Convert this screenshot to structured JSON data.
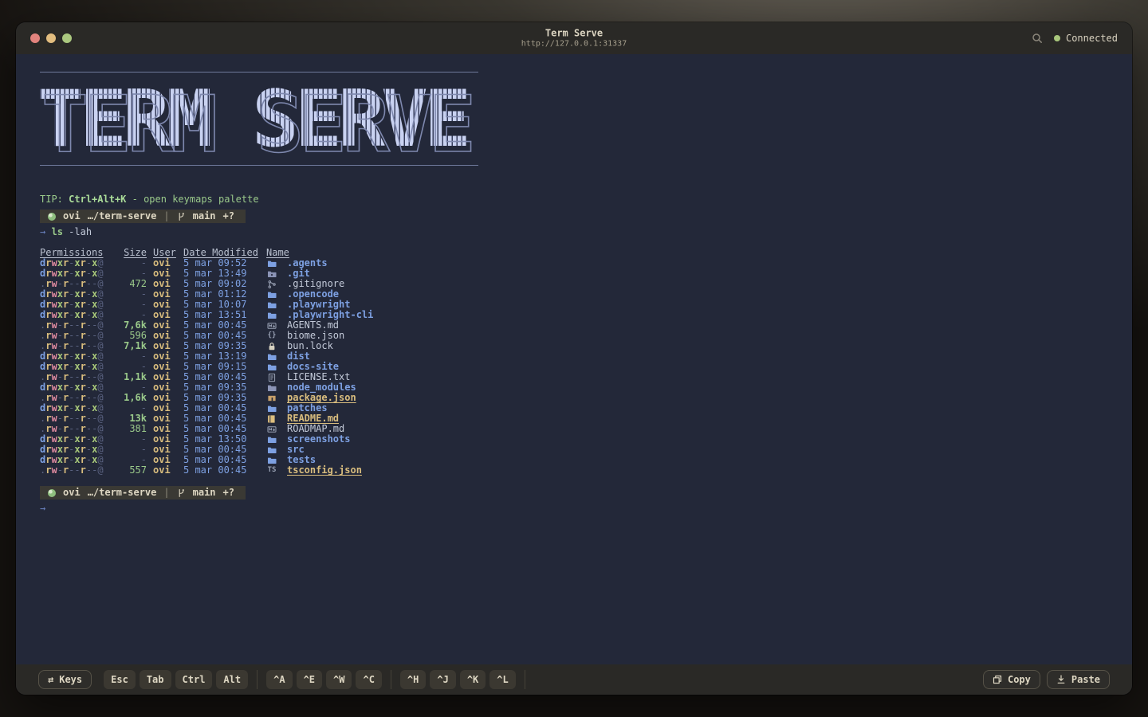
{
  "window": {
    "title": "Term Serve",
    "url": "http://127.0.0.1:31337",
    "connection_status": "Connected"
  },
  "logo": {
    "text": "TERM SERVE"
  },
  "tip": {
    "label": "TIP:",
    "hotkey": "Ctrl+Alt+K",
    "description": "- open keymaps palette"
  },
  "prompt": {
    "user": "ovi",
    "path": "…/term-serve",
    "separator": "|",
    "branch": "main",
    "git_flags": "+?"
  },
  "command": {
    "prompt_arrow": "→",
    "name": "ls",
    "args": "-lah"
  },
  "input_line": {
    "prompt_arrow": "→"
  },
  "listing": {
    "headers": [
      "Permissions",
      "Size",
      "User",
      "Date Modified",
      "Name"
    ],
    "rows": [
      {
        "perms": "drwxr-xr-x@",
        "size": "-",
        "user": "ovi",
        "date": "5 mar 09:52",
        "icon": "folder",
        "name": ".agents",
        "kind": "dir"
      },
      {
        "perms": "drwxr-xr-x@",
        "size": "-",
        "user": "ovi",
        "date": "5 mar 13:49",
        "icon": "folder-git",
        "name": ".git",
        "kind": "dir"
      },
      {
        "perms": ".rw-r--r--@",
        "size": "472",
        "user": "ovi",
        "date": "5 mar 09:02",
        "icon": "git",
        "name": ".gitignore",
        "kind": "file"
      },
      {
        "perms": "drwxr-xr-x@",
        "size": "-",
        "user": "ovi",
        "date": "5 mar 01:12",
        "icon": "folder",
        "name": ".opencode",
        "kind": "dir"
      },
      {
        "perms": "drwxr-xr-x@",
        "size": "-",
        "user": "ovi",
        "date": "5 mar 10:07",
        "icon": "folder",
        "name": ".playwright",
        "kind": "dir"
      },
      {
        "perms": "drwxr-xr-x@",
        "size": "-",
        "user": "ovi",
        "date": "5 mar 13:51",
        "icon": "folder",
        "name": ".playwright-cli",
        "kind": "dir"
      },
      {
        "perms": ".rw-r--r--@",
        "size": "7,6k",
        "user": "ovi",
        "date": "5 mar 00:45",
        "icon": "markdown",
        "name": "AGENTS.md",
        "kind": "file"
      },
      {
        "perms": ".rw-r--r--@",
        "size": "596",
        "user": "ovi",
        "date": "5 mar 00:45",
        "icon": "braces",
        "name": "biome.json",
        "kind": "file"
      },
      {
        "perms": ".rw-r--r--@",
        "size": "7,1k",
        "user": "ovi",
        "date": "5 mar 09:35",
        "icon": "lock",
        "name": "bun.lock",
        "kind": "file"
      },
      {
        "perms": "drwxr-xr-x@",
        "size": "-",
        "user": "ovi",
        "date": "5 mar 13:19",
        "icon": "folder",
        "name": "dist",
        "kind": "dir"
      },
      {
        "perms": "drwxr-xr-x@",
        "size": "-",
        "user": "ovi",
        "date": "5 mar 09:15",
        "icon": "folder",
        "name": "docs-site",
        "kind": "dir"
      },
      {
        "perms": ".rw-r--r--@",
        "size": "1,1k",
        "user": "ovi",
        "date": "5 mar 00:45",
        "icon": "doc",
        "name": "LICENSE.txt",
        "kind": "file"
      },
      {
        "perms": "drwxr-xr-x@",
        "size": "-",
        "user": "ovi",
        "date": "5 mar 09:35",
        "icon": "folder-npm",
        "name": "node_modules",
        "kind": "dir"
      },
      {
        "perms": ".rw-r--r--@",
        "size": "1,6k",
        "user": "ovi",
        "date": "5 mar 09:35",
        "icon": "npm",
        "name": "package.json",
        "kind": "special"
      },
      {
        "perms": "drwxr-xr-x@",
        "size": "-",
        "user": "ovi",
        "date": "5 mar 00:45",
        "icon": "folder",
        "name": "patches",
        "kind": "dir"
      },
      {
        "perms": ".rw-r--r--@",
        "size": "13k",
        "user": "ovi",
        "date": "5 mar 00:45",
        "icon": "book",
        "name": "README.md",
        "kind": "special"
      },
      {
        "perms": ".rw-r--r--@",
        "size": "381",
        "user": "ovi",
        "date": "5 mar 00:45",
        "icon": "markdown",
        "name": "ROADMAP.md",
        "kind": "file"
      },
      {
        "perms": "drwxr-xr-x@",
        "size": "-",
        "user": "ovi",
        "date": "5 mar 13:50",
        "icon": "folder",
        "name": "screenshots",
        "kind": "dir"
      },
      {
        "perms": "drwxr-xr-x@",
        "size": "-",
        "user": "ovi",
        "date": "5 mar 00:45",
        "icon": "folder",
        "name": "src",
        "kind": "dir"
      },
      {
        "perms": "drwxr-xr-x@",
        "size": "-",
        "user": "ovi",
        "date": "5 mar 00:45",
        "icon": "folder",
        "name": "tests",
        "kind": "dir"
      },
      {
        "perms": ".rw-r--r--@",
        "size": "557",
        "user": "ovi",
        "date": "5 mar 00:45",
        "icon": "ts",
        "name": "tsconfig.json",
        "kind": "special"
      }
    ]
  },
  "toolbar": {
    "keys_label": "Keys",
    "modifier_keys": [
      "Esc",
      "Tab",
      "Ctrl",
      "Alt"
    ],
    "ctrl_group_1": [
      "^A",
      "^E",
      "^W",
      "^C"
    ],
    "ctrl_group_2": [
      "^H",
      "^J",
      "^K",
      "^L"
    ],
    "copy_label": "Copy",
    "paste_label": "Paste"
  },
  "colors": {
    "terminal_bg": "#232839",
    "chrome_bg": "#2a2926",
    "logo": "#c9d2f1",
    "accent_green": "#9ac98a",
    "accent_blue": "#7da0e2",
    "accent_yellow": "#d9bd7e",
    "accent_pink": "#e08ba0",
    "connected_dot": "#a9c77c",
    "cream_text": "#ded7c3"
  }
}
